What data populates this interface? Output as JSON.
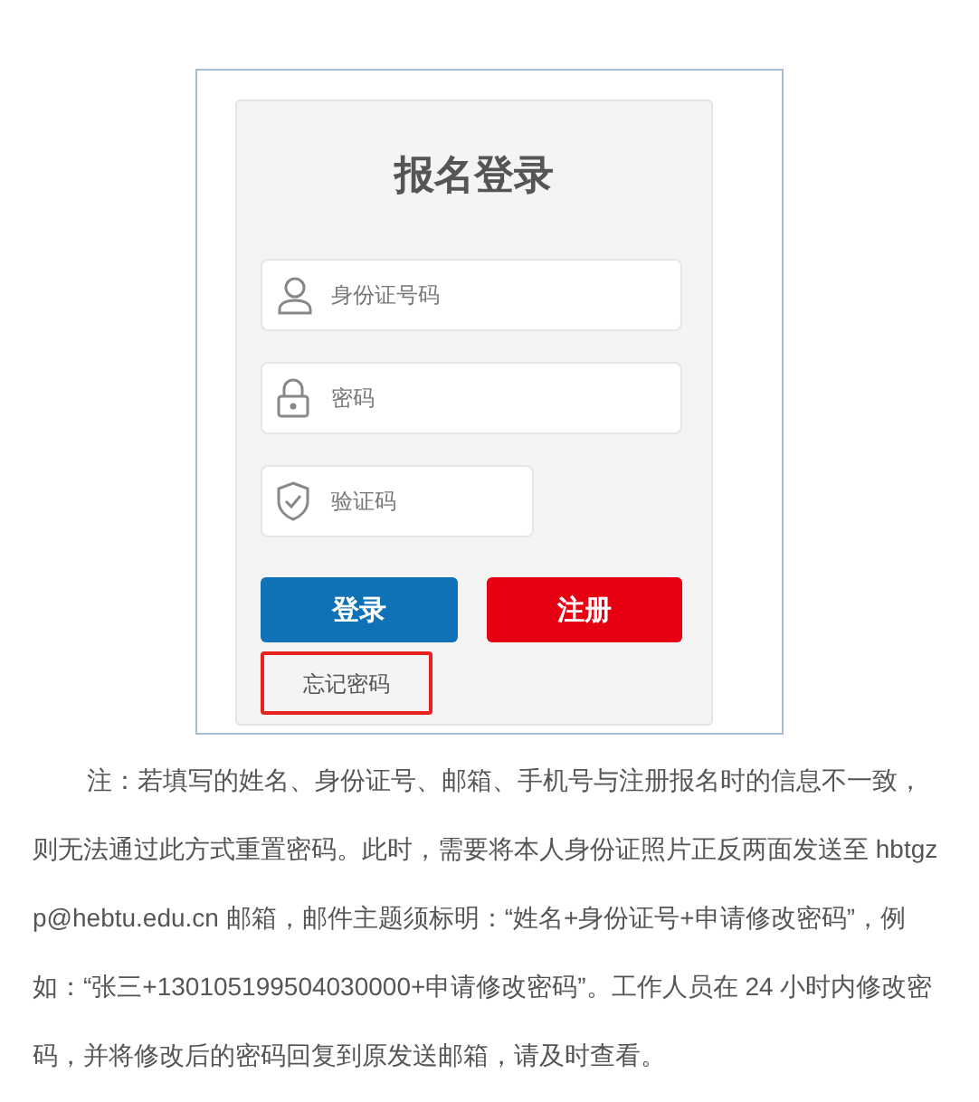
{
  "login_screenshot": {
    "title": "报名登录",
    "fields": [
      {
        "kind": "user",
        "placeholder": "身份证号码"
      },
      {
        "kind": "lock",
        "placeholder": "密码"
      },
      {
        "kind": "shield",
        "placeholder": "验证码"
      }
    ],
    "buttons": [
      {
        "kind": "primary",
        "label": "登录"
      },
      {
        "kind": "danger",
        "label": "注册"
      }
    ],
    "forgot_link": {
      "label": "忘记密码",
      "highlighted": true
    }
  },
  "note": "注：若填写的姓名、身份证号、邮箱、手机号与注册报名时的信息不一致，则无法通过此方式重置密码。此时，需要将本人身份证照片正反两面发送至 hbtgzp@hebtu.edu.cn 邮箱，邮件主题须标明：“姓名+身份证号+申请修改密码”，例如：“张三+130105199504030000+申请修改密码”。工作人员在 24 小时内修改密码，并将修改后的密码回复到原发送邮箱，请及时查看。"
}
